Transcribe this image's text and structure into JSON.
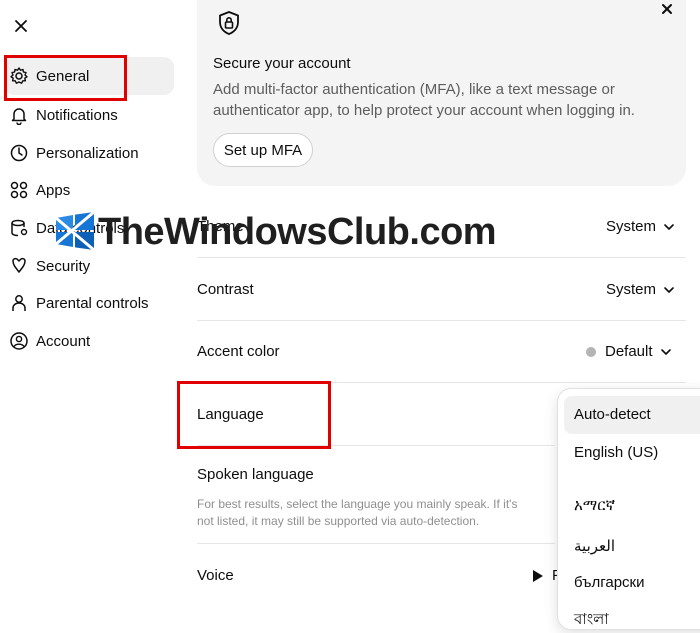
{
  "sidebar": {
    "close_icon": "close-icon",
    "items": [
      {
        "label": "General",
        "icon": "gear-icon",
        "active": true
      },
      {
        "label": "Notifications",
        "icon": "bell-icon"
      },
      {
        "label": "Personalization",
        "icon": "personalization-icon"
      },
      {
        "label": "Apps",
        "icon": "apps-grid-icon"
      },
      {
        "label": "Data controls",
        "icon": "database-icon"
      },
      {
        "label": "Security",
        "icon": "security-icon"
      },
      {
        "label": "Parental controls",
        "icon": "person-icon"
      },
      {
        "label": "Account",
        "icon": "account-icon"
      }
    ]
  },
  "mfa": {
    "title": "Secure your account",
    "description": "Add multi-factor authentication (MFA), like a text message or authenticator app, to help protect your account when logging in.",
    "button": "Set up MFA"
  },
  "settings": {
    "theme": {
      "label": "Theme",
      "value": "System"
    },
    "contrast": {
      "label": "Contrast",
      "value": "System"
    },
    "accent": {
      "label": "Accent color",
      "value": "Default",
      "dot_color": "#b4b4b4"
    },
    "language": {
      "label": "Language"
    },
    "spoken": {
      "label": "Spoken language",
      "hint": "For best results, select the language you mainly speak. If it's not listed, it may still be supported via auto-detection."
    },
    "voice": {
      "label": "Voice",
      "play_label": "Pl"
    }
  },
  "language_menu": {
    "options": [
      "Auto-detect",
      "English (US)",
      "አማርኛ",
      "العربية",
      "български",
      "বাংলা"
    ],
    "selected": "Auto-detect"
  },
  "watermark": {
    "text": "TheWindowsClub.com"
  },
  "colors": {
    "annotation_red": "#e00000",
    "card_bg": "#f4f4f4",
    "hover_bg": "#f0f0f0"
  }
}
